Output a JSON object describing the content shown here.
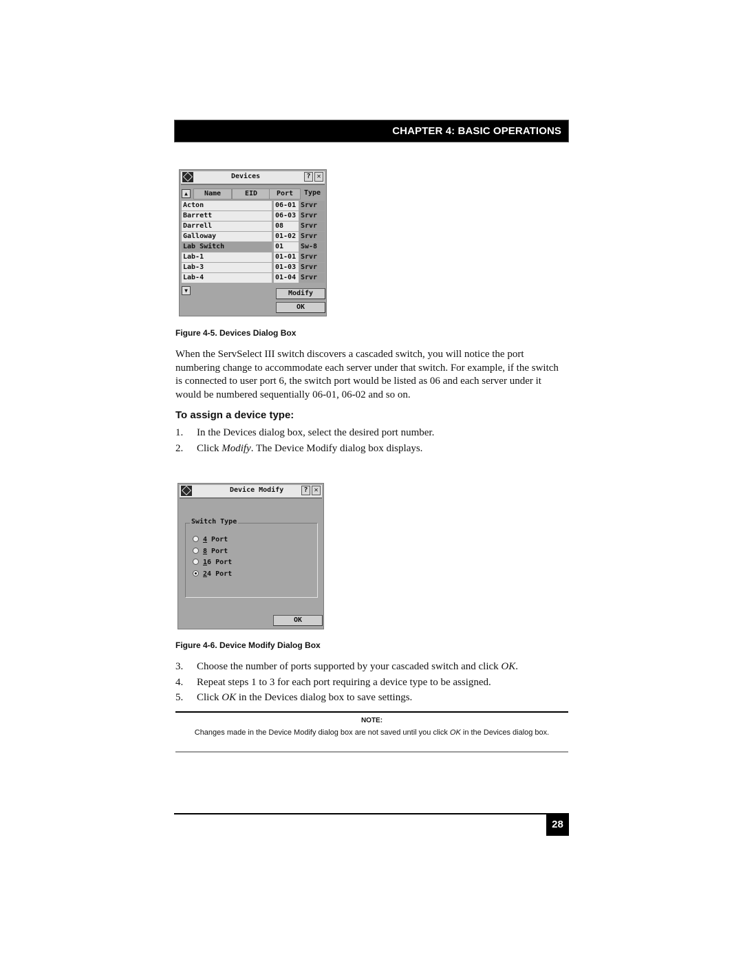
{
  "header": {
    "chapter": "CHAPTER 4: BASIC OPERATIONS"
  },
  "devices_dialog": {
    "title": "Devices",
    "help_label": "?",
    "close_label": "✕",
    "sort_up_label": "▲",
    "sort_down_label": "▼",
    "columns": {
      "name": "Name",
      "eid": "EID",
      "port": "Port",
      "type": "Type"
    },
    "rows": [
      {
        "name": "Acton",
        "port": "06-01",
        "type": "Srvr"
      },
      {
        "name": "Barrett",
        "port": "06-03",
        "type": "Srvr"
      },
      {
        "name": "Darrell",
        "port": "08",
        "type": "Srvr"
      },
      {
        "name": "Galloway",
        "port": "01-02",
        "type": "Srvr"
      },
      {
        "name": "Lab Switch",
        "port": "01",
        "type": "Sw-8"
      },
      {
        "name": "Lab-1",
        "port": "01-01",
        "type": "Srvr"
      },
      {
        "name": "Lab-3",
        "port": "01-03",
        "type": "Srvr"
      },
      {
        "name": "Lab-4",
        "port": "01-04",
        "type": "Srvr"
      }
    ],
    "selected_row": "Lab Switch",
    "modify_label": "Modify",
    "ok_label": "OK"
  },
  "figure5_caption": "Figure 4-5.  Devices Dialog Box",
  "paragraph": "When the ServSelect III switch discovers a cascaded switch, you will notice the port numbering change to accommodate each server under that switch. For example, if the switch is connected to user port 6, the switch port would be listed as 06 and each server under it would be numbered sequentially 06-01, 06-02 and so on.",
  "subheading": "To assign a device type:",
  "steps_a": [
    {
      "num": "1.",
      "text": "In the Devices dialog box, select the desired port number."
    },
    {
      "num": "2.",
      "pre": "Click ",
      "em": "Modify",
      "post": ". The Device Modify dialog box displays."
    }
  ],
  "modify_dialog": {
    "title": "Device Modify",
    "help_label": "?",
    "close_label": "✕",
    "group_label": "Switch Type",
    "options": [
      {
        "key": "4",
        "rest": " Port",
        "checked": false
      },
      {
        "key": "8",
        "rest": " Port",
        "checked": false
      },
      {
        "key": "1",
        "key_rest": "6",
        "rest": " Port",
        "checked": false
      },
      {
        "key": "2",
        "key_rest": "4",
        "rest": " Port",
        "checked": true
      }
    ],
    "ok_label": "OK"
  },
  "figure6_caption": "Figure 4-6.  Device Modify Dialog Box",
  "steps_b": [
    {
      "num": "3.",
      "pre": "Choose the number of ports supported by your cascaded switch and click ",
      "em": "OK",
      "post": "."
    },
    {
      "num": "4.",
      "pre": "Repeat steps 1 to 3 for each port requiring a device type to be assigned.",
      "em": "",
      "post": ""
    },
    {
      "num": "5.",
      "pre": "Click ",
      "em": "OK",
      "post": " in the Devices dialog box to save settings."
    }
  ],
  "note": {
    "label": "NOTE:",
    "pre": "Changes made in the Device Modify dialog box are not saved until you click ",
    "em": "OK",
    "post": " in the Devices dialog box."
  },
  "page_number": "28"
}
